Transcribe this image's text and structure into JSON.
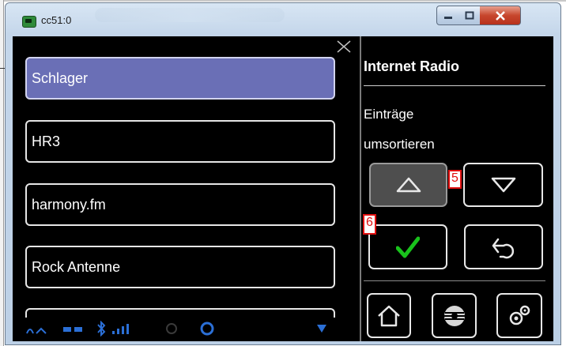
{
  "window": {
    "title": "cc51:0"
  },
  "station_list": [
    "Schlager",
    "HR3",
    "harmony.fm",
    "Rock Antenne",
    ""
  ],
  "panel": {
    "title": "Internet Radio",
    "subtitle_line1": "Einträge",
    "subtitle_line2": "umsortieren"
  },
  "markers": {
    "up": "5",
    "confirm": "6"
  },
  "icons": {
    "move_up": "triangle-up-icon",
    "move_down": "triangle-down-icon",
    "confirm": "checkmark-icon",
    "undo": "undo-icon",
    "home": "home-icon",
    "radio": "radio-icon",
    "settings": "gears-icon"
  },
  "colors": {
    "selected_station": "#6a6fb6",
    "confirm_check": "#19c21c",
    "marker": "#e01010",
    "status_icons": "#2b6fd6"
  }
}
